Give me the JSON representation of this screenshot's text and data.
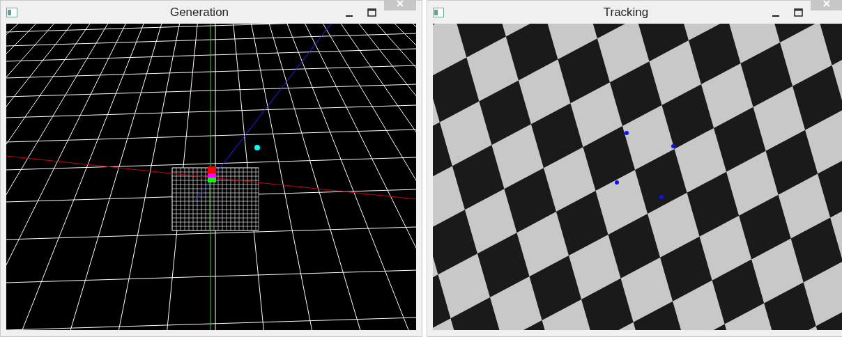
{
  "windows": [
    {
      "title": "Generation",
      "kind": "render"
    },
    {
      "title": "Tracking",
      "kind": "camera"
    }
  ]
}
